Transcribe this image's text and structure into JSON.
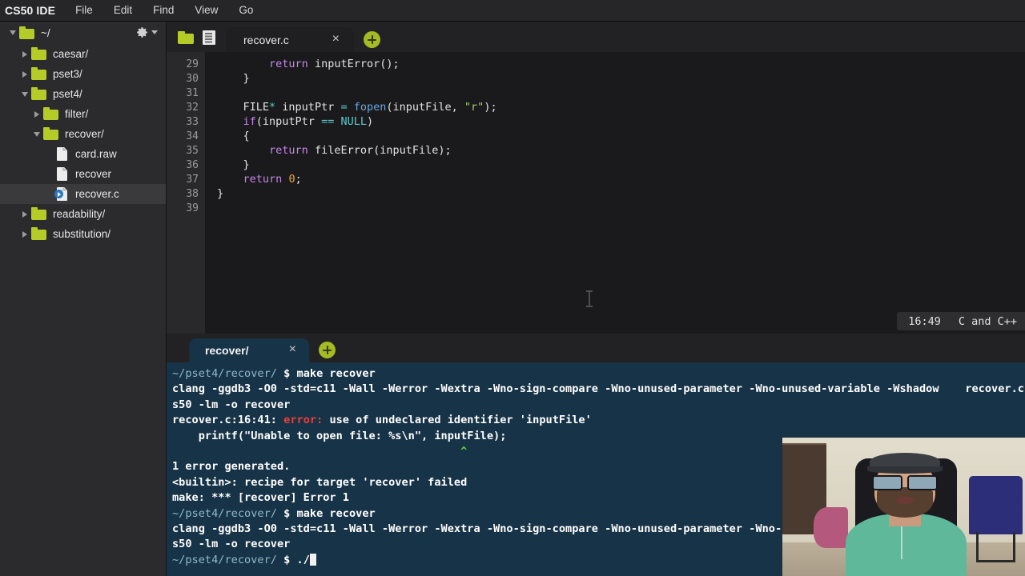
{
  "menubar": {
    "brand": "CS50 IDE",
    "items": [
      "File",
      "Edit",
      "Find",
      "View",
      "Go"
    ]
  },
  "sidebar": {
    "root": {
      "label": "~/",
      "icon": "folder-icon",
      "expanded": true
    },
    "gear_icon": "gear-icon",
    "items": [
      {
        "label": "caesar/",
        "type": "folder",
        "depth": 1,
        "expanded": false,
        "selected": false
      },
      {
        "label": "pset3/",
        "type": "folder",
        "depth": 1,
        "expanded": false,
        "selected": false
      },
      {
        "label": "pset4/",
        "type": "folder",
        "depth": 1,
        "expanded": true,
        "selected": false
      },
      {
        "label": "filter/",
        "type": "folder",
        "depth": 2,
        "expanded": false,
        "selected": false
      },
      {
        "label": "recover/",
        "type": "folder",
        "depth": 2,
        "expanded": true,
        "selected": false
      },
      {
        "label": "card.raw",
        "type": "file",
        "depth": 3,
        "selected": false
      },
      {
        "label": "recover",
        "type": "file",
        "depth": 3,
        "selected": false
      },
      {
        "label": "recover.c",
        "type": "cfile",
        "depth": 3,
        "selected": true
      },
      {
        "label": "readability/",
        "type": "folder",
        "depth": 1,
        "expanded": false,
        "selected": false
      },
      {
        "label": "substitution/",
        "type": "folder",
        "depth": 1,
        "expanded": false,
        "selected": false
      }
    ]
  },
  "editor": {
    "toolbar_icons": [
      "folder-icon",
      "document-icon"
    ],
    "tab": {
      "title": "recover.c",
      "close_label": "×"
    },
    "new_tab_label": "+",
    "status": {
      "time": "16:49",
      "language": "C and C++"
    },
    "lines": [
      {
        "num": "29",
        "tokens": [
          {
            "t": "        ",
            "c": "plain"
          },
          {
            "t": "return",
            "c": "kw"
          },
          {
            "t": " ",
            "c": "plain"
          },
          {
            "t": "inputError",
            "c": "plain"
          },
          {
            "t": "();",
            "c": "plain"
          }
        ]
      },
      {
        "num": "30",
        "tokens": [
          {
            "t": "    }",
            "c": "plain"
          }
        ]
      },
      {
        "num": "31",
        "tokens": [
          {
            "t": "",
            "c": "plain"
          }
        ]
      },
      {
        "num": "32",
        "tokens": [
          {
            "t": "    FILE",
            "c": "plain"
          },
          {
            "t": "*",
            "c": "op"
          },
          {
            "t": " inputPtr ",
            "c": "plain"
          },
          {
            "t": "=",
            "c": "op"
          },
          {
            "t": " ",
            "c": "plain"
          },
          {
            "t": "fopen",
            "c": "fn"
          },
          {
            "t": "(inputFile, ",
            "c": "plain"
          },
          {
            "t": "\"r\"",
            "c": "str"
          },
          {
            "t": ");",
            "c": "plain"
          }
        ]
      },
      {
        "num": "33",
        "tokens": [
          {
            "t": "    ",
            "c": "plain"
          },
          {
            "t": "if",
            "c": "kw"
          },
          {
            "t": "(inputPtr ",
            "c": "plain"
          },
          {
            "t": "==",
            "c": "op"
          },
          {
            "t": " ",
            "c": "plain"
          },
          {
            "t": "NULL",
            "c": "cst"
          },
          {
            "t": ")",
            "c": "plain"
          }
        ]
      },
      {
        "num": "34",
        "tokens": [
          {
            "t": "    {",
            "c": "plain"
          }
        ]
      },
      {
        "num": "35",
        "tokens": [
          {
            "t": "        ",
            "c": "plain"
          },
          {
            "t": "return",
            "c": "kw"
          },
          {
            "t": " fileError(inputFile);",
            "c": "plain"
          }
        ]
      },
      {
        "num": "36",
        "tokens": [
          {
            "t": "    }",
            "c": "plain"
          }
        ]
      },
      {
        "num": "37",
        "tokens": [
          {
            "t": "    ",
            "c": "plain"
          },
          {
            "t": "return",
            "c": "kw"
          },
          {
            "t": " ",
            "c": "plain"
          },
          {
            "t": "0",
            "c": "num"
          },
          {
            "t": ";",
            "c": "plain"
          }
        ]
      },
      {
        "num": "38",
        "tokens": [
          {
            "t": "}",
            "c": "plain"
          }
        ]
      },
      {
        "num": "39",
        "tokens": [
          {
            "t": "",
            "c": "plain"
          }
        ]
      }
    ]
  },
  "terminal": {
    "tab": {
      "title": "recover/",
      "close_label": "×"
    },
    "new_tab_label": "+",
    "lines": [
      {
        "segs": [
          {
            "t": "~/pset4/recover/ ",
            "c": "tpath"
          },
          {
            "t": "$ ",
            "c": "tdollar"
          },
          {
            "t": "make recover",
            "c": "tcmd"
          }
        ]
      },
      {
        "segs": [
          {
            "t": "clang -ggdb3 -O0 -std=c11 -Wall -Werror -Wextra -Wno-sign-compare -Wno-unused-parameter -Wno-unused-variable -Wshadow    recover.c",
            "c": "tbold"
          }
        ]
      },
      {
        "segs": [
          {
            "t": "s50 -lm -o recover",
            "c": "tbold"
          }
        ]
      },
      {
        "segs": [
          {
            "t": "recover.c:16:41: ",
            "c": "tbold"
          },
          {
            "t": "error: ",
            "c": "terr"
          },
          {
            "t": "use of undeclared identifier 'inputFile'",
            "c": "tbold"
          }
        ]
      },
      {
        "segs": [
          {
            "t": "    printf(\"Unable to open file: %s\\n\", inputFile);",
            "c": "tbold"
          }
        ]
      },
      {
        "segs": [
          {
            "t": "                                            ^",
            "c": "tcaret"
          }
        ]
      },
      {
        "segs": [
          {
            "t": "1 error generated.",
            "c": "tbold"
          }
        ]
      },
      {
        "segs": [
          {
            "t": "<builtin>: recipe for target 'recover' failed",
            "c": "tbold"
          }
        ]
      },
      {
        "segs": [
          {
            "t": "make: *** [recover] Error 1",
            "c": "tbold"
          }
        ]
      },
      {
        "segs": [
          {
            "t": "~/pset4/recover/ ",
            "c": "tpath"
          },
          {
            "t": "$ ",
            "c": "tdollar"
          },
          {
            "t": "make recover",
            "c": "tcmd"
          }
        ]
      },
      {
        "segs": [
          {
            "t": "clang -ggdb3 -O0 -std=c11 -Wall -Werror -Wextra -Wno-sign-compare -Wno-unused-parameter -Wno-",
            "c": "tbold"
          }
        ]
      },
      {
        "segs": [
          {
            "t": "s50 -lm -o recover",
            "c": "tbold"
          }
        ]
      },
      {
        "segs": [
          {
            "t": "~/pset4/recover/ ",
            "c": "tpath"
          },
          {
            "t": "$ ",
            "c": "tdollar"
          },
          {
            "t": "./",
            "c": "tcmd"
          },
          {
            "t": "█",
            "c": "cursor"
          }
        ]
      }
    ]
  },
  "webcam": {
    "label": "webcam-overlay"
  },
  "colors": {
    "menubar_bg": "#262628",
    "sidebar_bg": "#2b2b2d",
    "editor_bg": "#1a1a1c",
    "gutter_bg": "#29292b",
    "terminal_bg": "#173347",
    "accent_green": "#b5cc28",
    "error_red": "#e8403a",
    "caret_green": "#67d13a"
  }
}
